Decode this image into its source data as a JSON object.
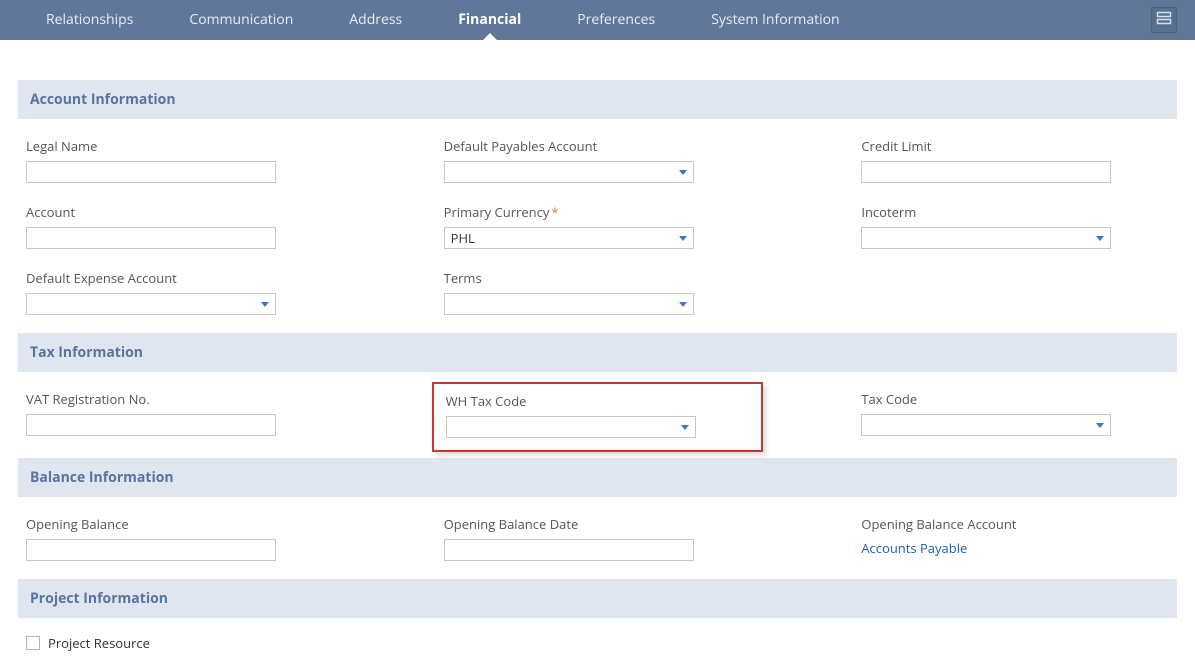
{
  "tabs": [
    {
      "label": "Relationships",
      "active": false
    },
    {
      "label": "Communication",
      "active": false
    },
    {
      "label": "Address",
      "active": false
    },
    {
      "label": "Financial",
      "active": true
    },
    {
      "label": "Preferences",
      "active": false
    },
    {
      "label": "System Information",
      "active": false
    }
  ],
  "sections": {
    "account": {
      "title": "Account Information",
      "fields": {
        "legal_name": {
          "label": "Legal Name",
          "value": ""
        },
        "account": {
          "label": "Account",
          "value": ""
        },
        "default_expense_account": {
          "label": "Default Expense Account",
          "value": ""
        },
        "default_payables_account": {
          "label": "Default Payables Account",
          "value": ""
        },
        "primary_currency": {
          "label": "Primary Currency",
          "value": "PHL",
          "required": true
        },
        "terms": {
          "label": "Terms",
          "value": ""
        },
        "credit_limit": {
          "label": "Credit Limit",
          "value": ""
        },
        "incoterm": {
          "label": "Incoterm",
          "value": ""
        }
      }
    },
    "tax": {
      "title": "Tax Information",
      "fields": {
        "vat_registration_no": {
          "label": "VAT Registration No.",
          "value": ""
        },
        "wh_tax_code": {
          "label": "WH Tax Code",
          "value": ""
        },
        "tax_code": {
          "label": "Tax Code",
          "value": ""
        }
      }
    },
    "balance": {
      "title": "Balance Information",
      "fields": {
        "opening_balance": {
          "label": "Opening Balance",
          "value": ""
        },
        "opening_balance_date": {
          "label": "Opening Balance Date",
          "value": ""
        },
        "opening_balance_account": {
          "label": "Opening Balance Account",
          "value": "Accounts Payable"
        }
      }
    },
    "project": {
      "title": "Project Information",
      "fields": {
        "project_resource": {
          "label": "Project Resource",
          "checked": false
        }
      }
    }
  }
}
